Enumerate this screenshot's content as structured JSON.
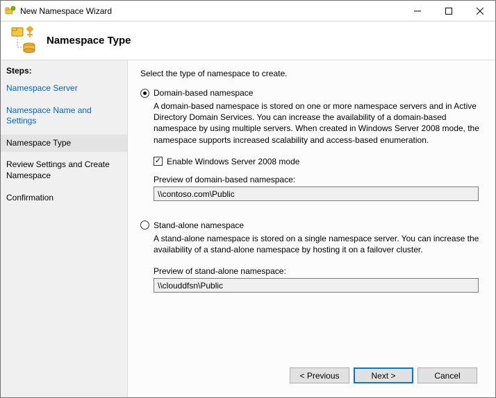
{
  "window": {
    "title": "New Namespace Wizard"
  },
  "header": {
    "title": "Namespace Type"
  },
  "sidebar": {
    "steps_label": "Steps:",
    "items": [
      {
        "label": "Namespace Server",
        "state": "past"
      },
      {
        "label": "Namespace Name and Settings",
        "state": "past"
      },
      {
        "label": "Namespace Type",
        "state": "current"
      },
      {
        "label": "Review Settings and Create Namespace",
        "state": "future"
      },
      {
        "label": "Confirmation",
        "state": "future"
      }
    ]
  },
  "content": {
    "instruction": "Select the type of namespace to create.",
    "option1": {
      "label": "Domain-based namespace",
      "selected": true,
      "description": "A domain-based namespace is stored on one or more namespace servers and in Active Directory Domain Services. You can increase the availability of a domain-based namespace by using multiple servers. When created in Windows Server 2008 mode, the namespace supports increased scalability and access-based enumeration.",
      "checkbox_label": "Enable Windows Server 2008 mode",
      "checkbox_checked": true,
      "preview_label": "Preview of domain-based namespace:",
      "preview_value": "\\\\contoso.com\\Public"
    },
    "option2": {
      "label": "Stand-alone namespace",
      "selected": false,
      "description": "A stand-alone namespace is stored on a single namespace server. You can increase the availability of a stand-alone namespace by hosting it on a failover cluster.",
      "preview_label": "Preview of stand-alone namespace:",
      "preview_value": "\\\\clouddfsn\\Public"
    }
  },
  "buttons": {
    "previous": "< Previous",
    "next": "Next >",
    "cancel": "Cancel"
  }
}
